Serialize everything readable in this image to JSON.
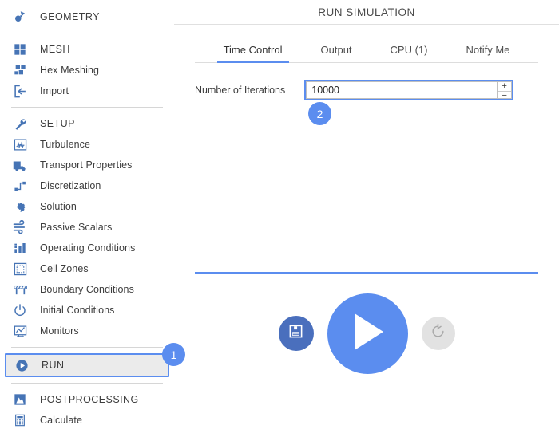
{
  "sidebar": {
    "groups": [
      {
        "items": [
          {
            "label": "GEOMETRY",
            "icon": "geometry-icon",
            "section": true,
            "selected": false
          }
        ]
      },
      {
        "items": [
          {
            "label": "MESH",
            "icon": "mesh-grid-icon",
            "section": true,
            "selected": false
          },
          {
            "label": "Hex Meshing",
            "icon": "hex-mesh-icon",
            "section": false,
            "selected": false
          },
          {
            "label": "Import",
            "icon": "import-icon",
            "section": false,
            "selected": false
          }
        ]
      },
      {
        "items": [
          {
            "label": "SETUP",
            "icon": "wrench-icon",
            "section": true,
            "selected": false
          },
          {
            "label": "Turbulence",
            "icon": "waveform-icon",
            "section": false,
            "selected": false
          },
          {
            "label": "Transport Properties",
            "icon": "truck-icon",
            "section": false,
            "selected": false
          },
          {
            "label": "Discretization",
            "icon": "node-path-icon",
            "section": false,
            "selected": false
          },
          {
            "label": "Solution",
            "icon": "gear-icon",
            "section": false,
            "selected": false
          },
          {
            "label": "Passive Scalars",
            "icon": "flow-lines-icon",
            "section": false,
            "selected": false
          },
          {
            "label": "Operating Conditions",
            "icon": "bar-chart-icon",
            "section": false,
            "selected": false
          },
          {
            "label": "Cell Zones",
            "icon": "dashed-box-icon",
            "section": false,
            "selected": false
          },
          {
            "label": "Boundary Conditions",
            "icon": "barrier-icon",
            "section": false,
            "selected": false
          },
          {
            "label": "Initial Conditions",
            "icon": "power-icon",
            "section": false,
            "selected": false
          },
          {
            "label": "Monitors",
            "icon": "monitor-chart-icon",
            "section": false,
            "selected": false
          }
        ]
      },
      {
        "items": [
          {
            "label": "RUN",
            "icon": "play-circle-icon",
            "section": true,
            "selected": true
          }
        ]
      },
      {
        "items": [
          {
            "label": "POSTPROCESSING",
            "icon": "postprocessing-icon",
            "section": true,
            "selected": false
          },
          {
            "label": "Calculate",
            "icon": "calculator-icon",
            "section": false,
            "selected": false
          }
        ]
      }
    ]
  },
  "main": {
    "title": "RUN SIMULATION",
    "tabs": [
      {
        "label": "Time Control",
        "active": true
      },
      {
        "label": "Output",
        "active": false
      },
      {
        "label": "CPU  (1)",
        "active": false
      },
      {
        "label": "Notify Me",
        "active": false
      }
    ],
    "field": {
      "label": "Number of Iterations",
      "value": "10000",
      "placeholder": "",
      "increment_label": "+",
      "decrement_label": "−"
    },
    "controls": {
      "save_icon": "floppy-disk-icon",
      "run_icon": "play-icon",
      "reset_icon": "reset-icon"
    }
  },
  "badges": [
    {
      "id": "badge-1",
      "label": "1"
    },
    {
      "id": "badge-2",
      "label": "2"
    }
  ],
  "colors": {
    "accent": "#5b8def",
    "icon_blue": "#4674b5",
    "save_blue": "#4a6fbd",
    "reset_gray": "#e2e2e2",
    "selected_bg": "#ebebeb"
  }
}
